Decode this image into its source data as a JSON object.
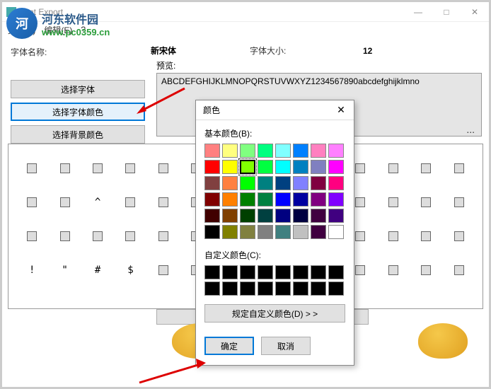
{
  "window": {
    "title": "Font Export",
    "min": "—",
    "max": "□",
    "close": "✕"
  },
  "menu": {
    "file": "文件(F)",
    "edit": "编辑(E)",
    "unknown": "?"
  },
  "watermark": {
    "cn": "河东软件园",
    "url": "www.pc0359.cn"
  },
  "labels": {
    "font_name": "字体名称:",
    "font_size": "字体大小:",
    "preview": "预览:"
  },
  "values": {
    "font_name": "新宋体",
    "font_size": "12",
    "preview_text": "ABCDEFGHIJKLMNOPQRSTUVWXYZ1234567890abcdefghijklmno"
  },
  "buttons": {
    "select_font": "选择字体",
    "select_font_color": "选择字体颜色",
    "select_bg_color": "选择背景颜色"
  },
  "grid_chars": [
    "",
    "",
    "",
    "",
    "",
    "",
    "",
    "",
    "",
    "",
    "",
    "",
    "",
    "",
    "",
    "",
    "^",
    "",
    "",
    "",
    "",
    "",
    "",
    "",
    "",
    "",
    "",
    "",
    "",
    "",
    "",
    "",
    "",
    "",
    "",
    "",
    "",
    "",
    "",
    "",
    "",
    "",
    "!",
    "\"",
    "#",
    "$",
    "",
    "",
    "",
    "",
    "",
    "",
    "",
    "",
    "",
    ""
  ],
  "dialog": {
    "title": "颜色",
    "close": "✕",
    "basic_label": "基本颜色(B):",
    "custom_label": "自定义颜色(C):",
    "define_btn": "规定自定义颜色(D) > >",
    "ok": "确定",
    "cancel": "取消",
    "basic_colors": [
      "#ff8080",
      "#ffff80",
      "#80ff80",
      "#00ff80",
      "#80ffff",
      "#0080ff",
      "#ff80c0",
      "#ff80ff",
      "#ff0000",
      "#ffff00",
      "#80ff00",
      "#00ff40",
      "#00ffff",
      "#0080c0",
      "#8080c0",
      "#ff00ff",
      "#804040",
      "#ff8040",
      "#00ff00",
      "#008080",
      "#004080",
      "#8080ff",
      "#800040",
      "#ff0080",
      "#800000",
      "#ff8000",
      "#008000",
      "#008040",
      "#0000ff",
      "#0000a0",
      "#800080",
      "#8000ff",
      "#400000",
      "#804000",
      "#004000",
      "#004040",
      "#000080",
      "#000040",
      "#400040",
      "#400080",
      "#000000",
      "#808000",
      "#808040",
      "#808080",
      "#408080",
      "#c0c0c0",
      "#400040",
      "#ffffff"
    ],
    "selected_index": 10,
    "custom_colors": [
      "#000000",
      "#000000",
      "#000000",
      "#000000",
      "#000000",
      "#000000",
      "#000000",
      "#000000",
      "#000000",
      "#000000",
      "#000000",
      "#000000",
      "#000000",
      "#000000",
      "#000000",
      "#000000"
    ]
  }
}
